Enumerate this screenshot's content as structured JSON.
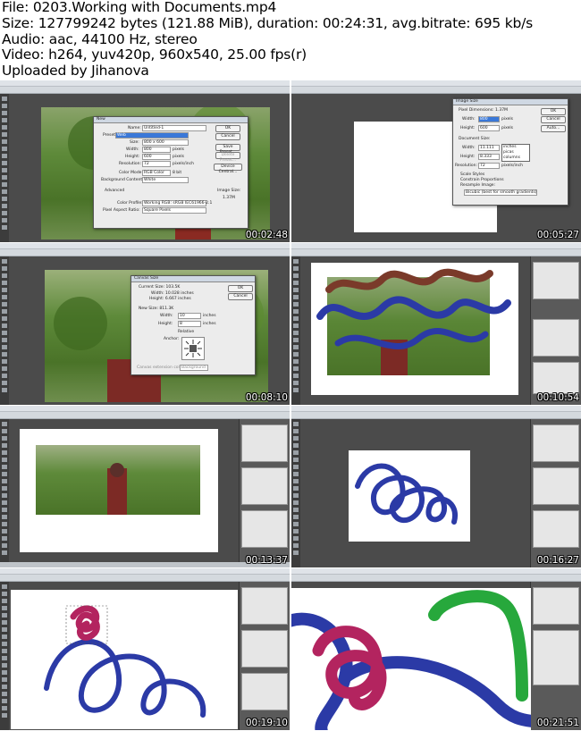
{
  "header": {
    "file": "File: 0203.Working with Documents.mp4",
    "size": "Size: 127799242 bytes (121.88 MiB), duration: 00:24:31, avg.bitrate: 695 kb/s",
    "audio": "Audio: aac, 44100 Hz, stereo",
    "video": "Video: h264, yuv420p, 960x540, 25.00 fps(r)",
    "uploader": "Uploaded by Jihanova"
  },
  "thumbnails": [
    {
      "timestamp": "00:02:48",
      "dialog": {
        "title": "New",
        "ok": "OK",
        "cancel": "Cancel",
        "save_preset": "Save Preset...",
        "delete_preset": "Delete Preset...",
        "device_central": "Device Central...",
        "name_label": "Name:",
        "name_value": "Untitled-1",
        "preset_label": "Preset:",
        "preset_value": "Web",
        "size_label": "Size:",
        "size_value": "800 x 600",
        "width_label": "Width:",
        "width_value": "800",
        "height_label": "Height:",
        "height_value": "600",
        "resolution_label": "Resolution:",
        "resolution_value": "72",
        "unit_pixels": "pixels",
        "unit_ppi": "pixels/inch",
        "color_mode_label": "Color Mode:",
        "color_mode_value": "RGB Color",
        "bits_value": "8 bit",
        "background_label": "Background Contents:",
        "background_value": "White",
        "advanced_label": "Advanced",
        "profile_label": "Color Profile:",
        "profile_value": "Working RGB: sRGB IEC61966-2.1",
        "pixel_aspect_label": "Pixel Aspect Ratio:",
        "pixel_aspect_value": "Square Pixels",
        "image_size_label": "Image Size:",
        "image_size_value": "1.37M"
      }
    },
    {
      "timestamp": "00:05:27",
      "dialog": {
        "title": "Image Size",
        "ok": "OK",
        "cancel": "Cancel",
        "auto": "Auto...",
        "pixel_dimensions": "Pixel Dimensions: 1.37M",
        "width_label": "Width:",
        "width_value": "800",
        "height_label": "Height:",
        "height_value": "600",
        "unit_pixels": "pixels",
        "document_size": "Document Size:",
        "doc_width_value": "11.111",
        "doc_height_value": "8.333",
        "unit_inches": "inches",
        "resolution_label": "Resolution:",
        "resolution_value": "72",
        "unit_ppi": "pixels/inch",
        "scale_styles": "Scale Styles",
        "constrain": "Constrain Proportions",
        "resample": "Resample Image:",
        "resample_value": "Bicubic (best for smooth gradients)",
        "dropdown_options": [
          "inches",
          "picas",
          "columns"
        ]
      }
    },
    {
      "timestamp": "00:08:10",
      "dialog": {
        "title": "Canvas Size",
        "ok": "OK",
        "cancel": "Cancel",
        "current_size": "Current Size: 103.5K",
        "cur_width": "Width: 10.028 inches",
        "cur_height": "Height: 6.667 inches",
        "new_size": "New Size: 811.3K",
        "width_label": "Width:",
        "width_value": "10",
        "height_label": "Height:",
        "height_value": "8",
        "unit_inches": "inches",
        "relative": "Relative",
        "anchor": "Anchor:",
        "ext_color_label": "Canvas extension color:",
        "ext_color_value": "Background"
      }
    },
    {
      "timestamp": "00:10:54"
    },
    {
      "timestamp": "00:13:37"
    },
    {
      "timestamp": "00:16:27"
    },
    {
      "timestamp": "00:19:10"
    },
    {
      "timestamp": "00:21:51"
    }
  ],
  "colors": {
    "stroke_blue": "#2b3aa6",
    "stroke_brown": "#7a3a2a",
    "stroke_magenta": "#b3245f",
    "stroke_green": "#27a83c",
    "ivy_green": "#4d7a2c"
  }
}
